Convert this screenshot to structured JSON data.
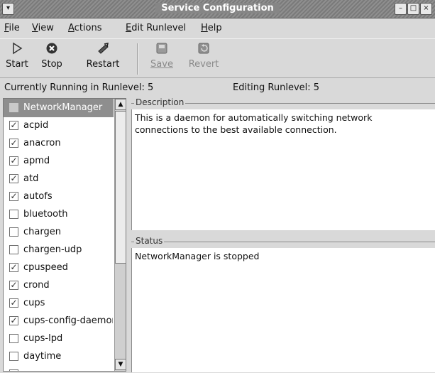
{
  "window": {
    "title": "Service Configuration",
    "buttons": {
      "menu": "▾",
      "minimize": "–",
      "maximize": "□",
      "close": "×"
    }
  },
  "menubar": [
    {
      "mnemonic": "F",
      "rest": "ile"
    },
    {
      "mnemonic": "V",
      "rest": "iew"
    },
    {
      "mnemonic": "A",
      "rest": "ctions"
    },
    {
      "mnemonic": "E",
      "rest": "dit Runlevel"
    },
    {
      "mnemonic": "H",
      "rest": "elp"
    }
  ],
  "toolbar": {
    "start": {
      "label": "Start",
      "icon": "play-icon"
    },
    "stop": {
      "label": "Stop",
      "icon": "stop-icon"
    },
    "restart": {
      "label": "Restart",
      "icon": "restart-icon"
    },
    "save": {
      "label": "Save",
      "icon": "save-icon",
      "enabled": false
    },
    "revert": {
      "label": "Revert",
      "icon": "revert-icon",
      "enabled": false
    }
  },
  "runlevel": {
    "current": "Currently Running in Runlevel: 5",
    "editing": "Editing Runlevel: 5"
  },
  "services": [
    {
      "name": "NetworkManager",
      "checked": false,
      "selected": true
    },
    {
      "name": "acpid",
      "checked": true
    },
    {
      "name": "anacron",
      "checked": true
    },
    {
      "name": "apmd",
      "checked": true
    },
    {
      "name": "atd",
      "checked": true
    },
    {
      "name": "autofs",
      "checked": true
    },
    {
      "name": "bluetooth",
      "checked": false
    },
    {
      "name": "chargen",
      "checked": false
    },
    {
      "name": "chargen-udp",
      "checked": false
    },
    {
      "name": "cpuspeed",
      "checked": true
    },
    {
      "name": "crond",
      "checked": true
    },
    {
      "name": "cups",
      "checked": true
    },
    {
      "name": "cups-config-daemon",
      "checked": true
    },
    {
      "name": "cups-lpd",
      "checked": false
    },
    {
      "name": "daytime",
      "checked": false
    }
  ],
  "description": {
    "label": "Description",
    "text": "This is a daemon for automatically switching network\nconnections to the best available connection."
  },
  "status": {
    "label": "Status",
    "text": "NetworkManager is stopped"
  }
}
